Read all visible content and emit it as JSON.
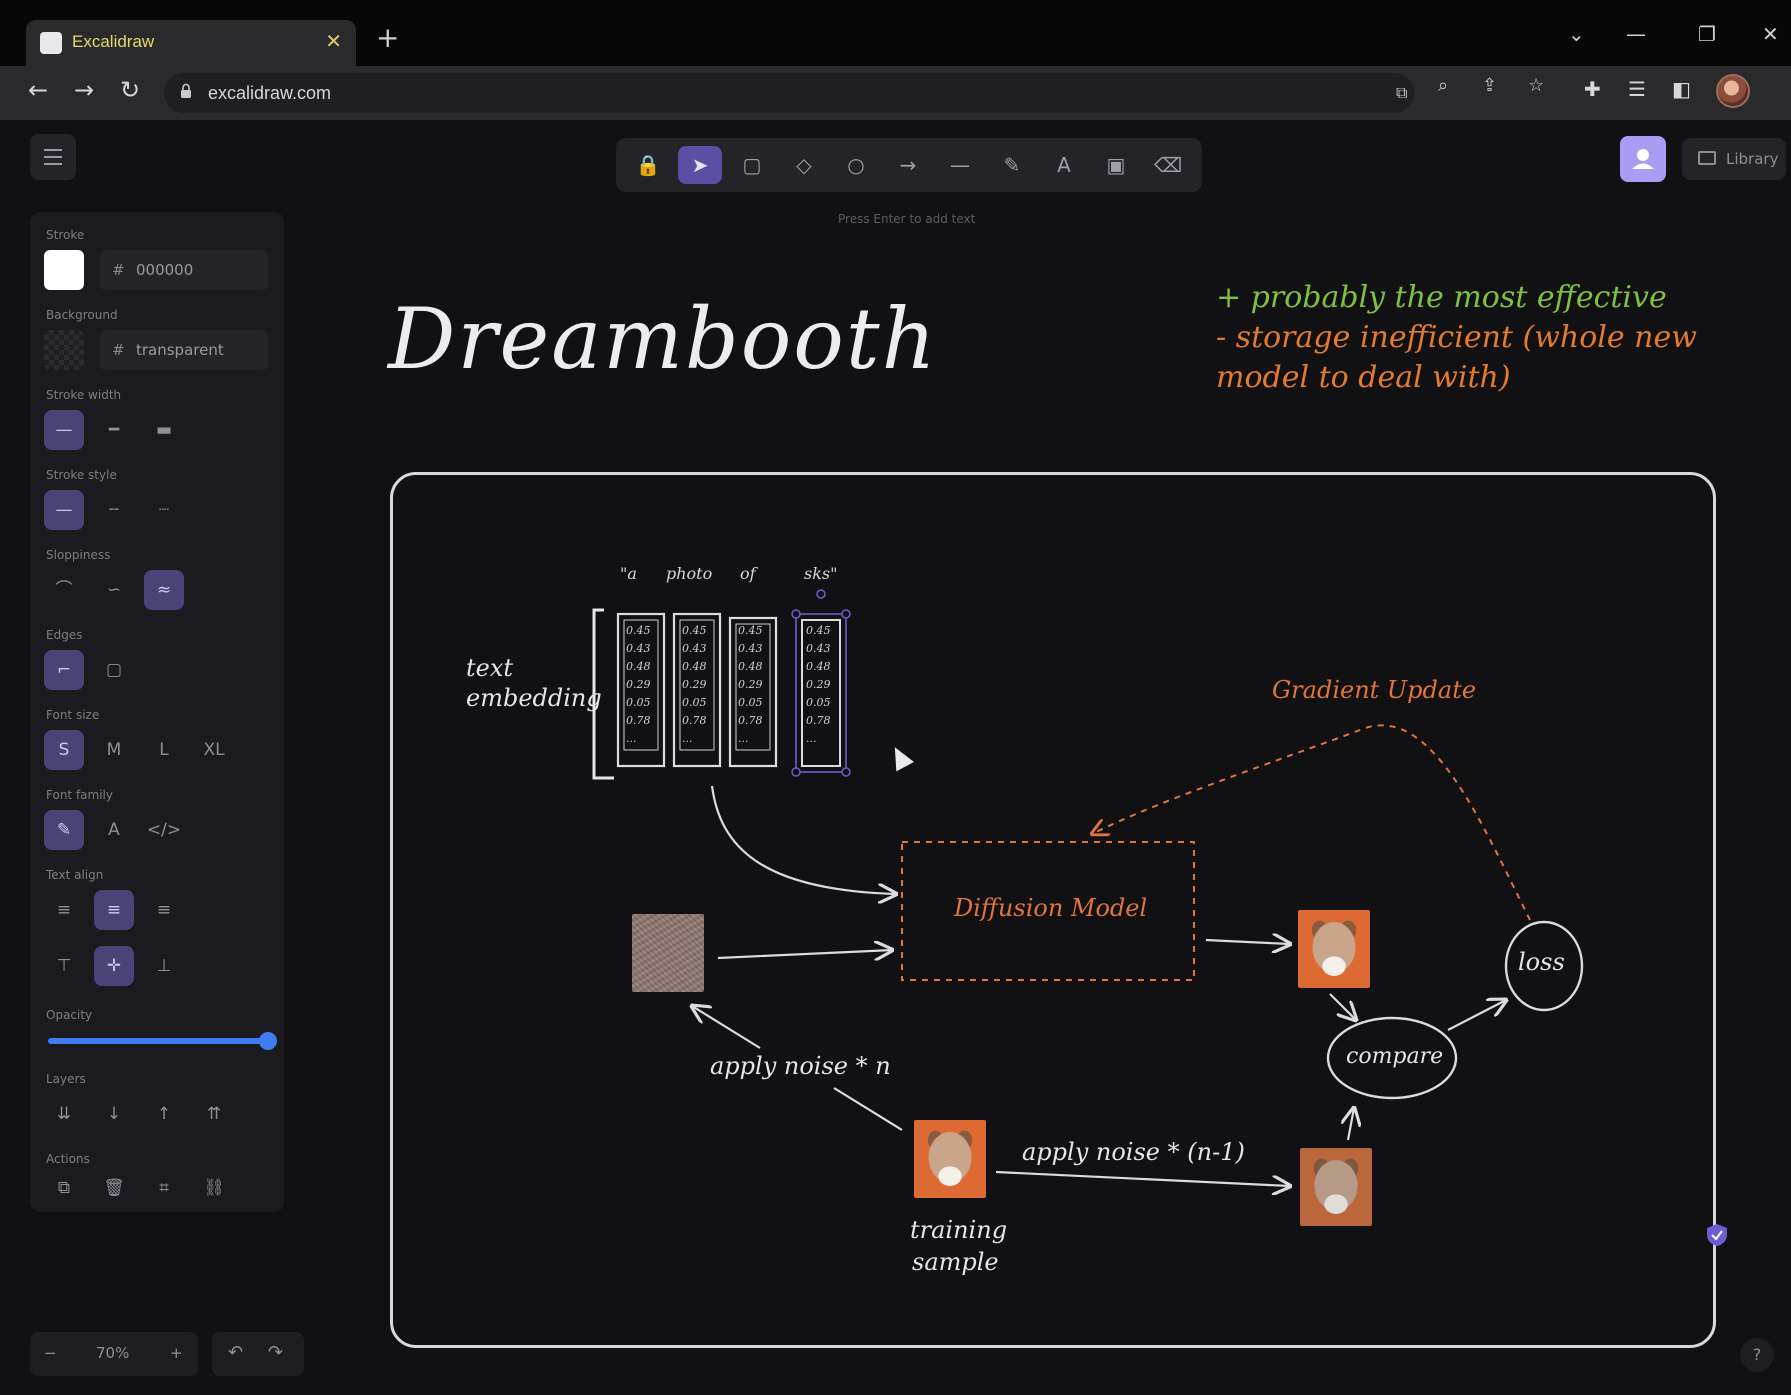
{
  "browser": {
    "tab_title": "Excalidraw",
    "tab_close": "✕",
    "new_tab": "+",
    "url": "excalidraw.com",
    "window_controls": [
      "⌄",
      "—",
      "❐",
      "✕"
    ],
    "nav": {
      "back": "←",
      "forward": "→",
      "reload": "↻"
    }
  },
  "toolbar": {
    "hint": "Press Enter to add text",
    "tools": [
      {
        "name": "lock-tool",
        "glyph": "🔒",
        "active": false
      },
      {
        "name": "selection-tool",
        "glyph": "➤",
        "active": true
      },
      {
        "name": "rectangle-tool",
        "glyph": "▢",
        "active": false
      },
      {
        "name": "diamond-tool",
        "glyph": "◇",
        "active": false
      },
      {
        "name": "ellipse-tool",
        "glyph": "○",
        "active": false
      },
      {
        "name": "arrow-tool",
        "glyph": "→",
        "active": false
      },
      {
        "name": "line-tool",
        "glyph": "—",
        "active": false
      },
      {
        "name": "draw-tool",
        "glyph": "✎",
        "active": false
      },
      {
        "name": "text-tool",
        "glyph": "A",
        "active": false
      },
      {
        "name": "image-tool",
        "glyph": "▣",
        "active": false
      },
      {
        "name": "eraser-tool",
        "glyph": "⌫",
        "active": false
      }
    ]
  },
  "topright": {
    "library_label": "Library"
  },
  "panel": {
    "stroke_label": "Stroke",
    "stroke_hex": "000000",
    "background_label": "Background",
    "background_value": "transparent",
    "stroke_width_label": "Stroke width",
    "stroke_style_label": "Stroke style",
    "sloppiness_label": "Sloppiness",
    "edges_label": "Edges",
    "font_size_label": "Font size",
    "font_sizes": [
      "S",
      "M",
      "L",
      "XL"
    ],
    "font_family_label": "Font family",
    "text_align_label": "Text align",
    "opacity_label": "Opacity",
    "opacity_value": 100,
    "layers_label": "Layers",
    "actions_label": "Actions"
  },
  "footer": {
    "zoom_out": "−",
    "zoom_level": "70%",
    "zoom_in": "+",
    "undo": "↶",
    "redo": "↷",
    "help": "?"
  },
  "drawing": {
    "title": "Dreambooth",
    "pros": "+ probably the most effective",
    "cons_line1": "- storage inefficient (whole new",
    "cons_line2": "model to deal with)",
    "tokens": [
      "\"a",
      "photo",
      "of",
      "sks\""
    ],
    "text_embedding_line1": "text",
    "text_embedding_line2": "embedding",
    "embedding_cells": [
      "0.45",
      "0.43",
      "0.48",
      "0.29",
      "0.05",
      "0.78",
      "..."
    ],
    "gradient_update": "Gradient Update",
    "diffusion_model": "Diffusion Model",
    "loss": "loss",
    "compare": "compare",
    "apply_noise_n": "apply noise * n",
    "apply_noise_n1": "apply noise * (n-1)",
    "training_sample_line1": "training",
    "training_sample_line2": "sample"
  },
  "colors": {
    "accent": "#5a4ea5",
    "accent_light": "#a89cf5",
    "pros": "#7fbf42",
    "cons": "#e47a2d",
    "slider": "#3f7cf0"
  }
}
